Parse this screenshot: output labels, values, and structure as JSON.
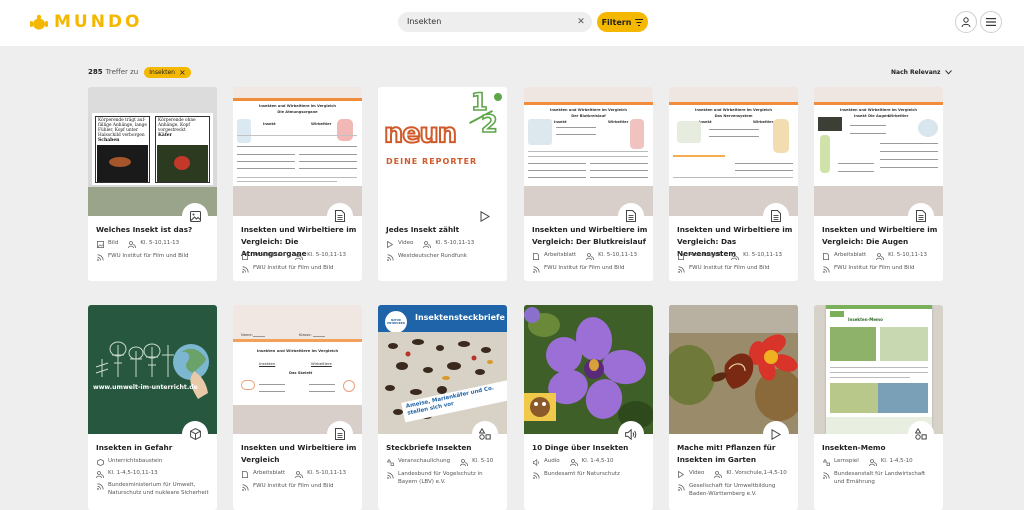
{
  "header": {
    "logo_text": "MUNDO",
    "search_value": "Insekten",
    "filter_label": "Filtern",
    "user_icon": "user-icon",
    "menu_icon": "hamburger-menu-icon",
    "brand_color": "#f5b800"
  },
  "results": {
    "count": "285",
    "label": "Treffer zu",
    "chip_label": "Insekten",
    "sort_label": "Nach Relevanz"
  },
  "cards": [
    {
      "title": "Welches Insekt ist das?",
      "type": "Bild",
      "grade": "Kl. 5-10,11-13",
      "source": "FWU Institut für Film und Bild",
      "badge_icon": "image-icon",
      "thumb": {
        "left_text": "Körperende trägt auf-\nfällige Anhänge, lange\nFühler, Kopf unter\nHalsschild verborgen",
        "left_name": "Schaben",
        "right_text": "Körperende ohne\nAnhänge, Kopf\nvorgestreckt",
        "right_name": "Käfer"
      }
    },
    {
      "title": "Insekten und Wirbeltiere im Vergleich: Die Atmungsorgane",
      "type": "Arbeitsblatt",
      "grade": "Kl. 5-10,11-13",
      "source": "FWU Institut für Film und Bild",
      "badge_icon": "document-icon",
      "thumb": {
        "heading": "Insekten und Wirbeltiere im Vergleich",
        "subheading": "Die Atmungsorgane",
        "col_a": "Insekt",
        "col_b": "Wirbeltier"
      }
    },
    {
      "title": "Jedes Insekt zählt",
      "type": "Video",
      "grade": "Kl. 5-10,11-13",
      "source": "Westdeutscher Rundfunk",
      "badge_icon": "play-icon",
      "thumb": {
        "logo_word": "neun",
        "fraction_top": "1",
        "fraction_bottom": "2",
        "tagline": "DEINE REPORTER"
      }
    },
    {
      "title": "Insekten und Wirbeltiere im Vergleich: Der Blutkreislauf",
      "type": "Arbeitsblatt",
      "grade": "Kl. 5-10,11-13",
      "source": "FWU Institut für Film und Bild",
      "badge_icon": "document-icon",
      "thumb": {
        "heading": "Insekten und Wirbeltiere im Vergleich",
        "subheading": "Der Blutkreislauf",
        "col_a": "Insekt",
        "col_b": "Wirbeltier"
      }
    },
    {
      "title": "Insekten und Wirbeltiere im Vergleich: Das Nervensystem",
      "type": "Arbeitsblatt",
      "grade": "Kl. 5-10,11-13",
      "source": "FWU Institut für Film und Bild",
      "badge_icon": "document-icon",
      "thumb": {
        "heading": "Insekten und Wirbeltiere im Vergleich",
        "subheading": "Das Nervensystem",
        "col_a": "Insekt",
        "col_b": "Wirbeltier"
      }
    },
    {
      "title": "Insekten und Wirbeltiere im Vergleich: Die Augen",
      "type": "Arbeitsblatt",
      "grade": "Kl. 5-10,11-13",
      "source": "FWU Institut für Film und Bild",
      "badge_icon": "document-icon",
      "thumb": {
        "heading": "Insekten und Wirbeltiere im Vergleich",
        "subheading": "Die Augen",
        "col_a": "Insekt",
        "col_b": "Wirbeltier"
      }
    },
    {
      "title": "Insekten in Gefahr",
      "type": "Unterrichtsbaustein",
      "grade": "Kl. 1-4,5-10,11-13",
      "source": "Bundesministerium für Umwelt, Naturschutz und nukleare Sicherheit",
      "badge_icon": "cube-icon",
      "thumb": {
        "url_text": "www.umwelt-im-unterricht.de"
      }
    },
    {
      "title": "Insekten und Wirbeltiere im Vergleich",
      "type": "Arbeitsblatt",
      "grade": "Kl. 5-10,11-13",
      "source": "FWU Institut für Film und Bild",
      "badge_icon": "document-icon",
      "thumb": {
        "name_label": "Name:",
        "class_label": "Klasse:",
        "heading": "Insekten und Wirbeltiere im Vergleich",
        "col_a": "Insekten",
        "col_b": "Wirbeltiere",
        "sub": "Das Skelett"
      }
    },
    {
      "title": "Steckbriefe Insekten",
      "type": "Veranschaulichung",
      "grade": "Kl. 5-10",
      "source": "Landesbund für Vogelschutz in Bayern (LBV) e.V.",
      "badge_icon": "shapes-icon",
      "thumb": {
        "banner": "Insektensteckbriefe",
        "badge_text": "NATUR ENTDECKEN",
        "tape_text": "Ameise, Marienkäfer und Co. stellen sich vor"
      }
    },
    {
      "title": "10 Dinge über Insekten",
      "type": "Audio",
      "grade": "Kl. 1-4,5-10",
      "source": "Bundesamt für Naturschutz",
      "badge_icon": "speaker-icon"
    },
    {
      "title": "Mache mit! Pflanzen für Insekten im Garten",
      "type": "Video",
      "grade": "Kl. Vorschule,1-4,5-10",
      "source": "Gesellschaft für Umweltbildung Baden-Württemberg e.V.",
      "badge_icon": "play-icon"
    },
    {
      "title": "Insekten-Memo",
      "type": "Lernspiel",
      "grade": "Kl. 1-4,5-10",
      "source": "Bundesanstalt für Landwirtschaft und Ernährung",
      "badge_icon": "shapes-icon",
      "thumb": {
        "heading": "Insekten-Memo"
      }
    }
  ]
}
